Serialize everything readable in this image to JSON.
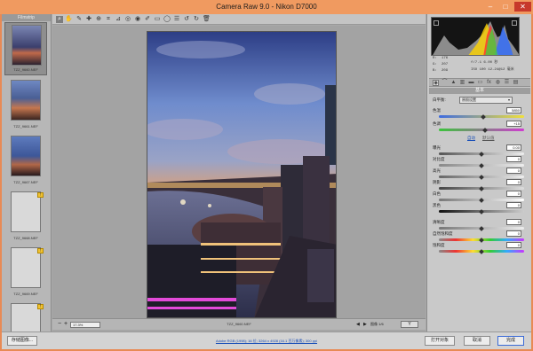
{
  "window": {
    "title": "Camera Raw 9.0  -  Nikon D7000",
    "minimize": "–",
    "maximize": "□",
    "close": "✕"
  },
  "filmstrip": {
    "header": "Filmstrip",
    "items": [
      {
        "name": "TZZ_9660.NEF",
        "stars": "· · · · ·",
        "selected": true,
        "warning": false,
        "has_image": true
      },
      {
        "name": "TZZ_9661.NEF",
        "stars": "",
        "selected": false,
        "warning": false,
        "has_image": true
      },
      {
        "name": "TZZ_9667.NEF",
        "stars": "",
        "selected": false,
        "warning": false,
        "has_image": true
      },
      {
        "name": "TZZ_9668.NEF",
        "stars": "",
        "selected": false,
        "warning": true,
        "has_image": false
      },
      {
        "name": "TZZ_9669.NEF",
        "stars": "",
        "selected": false,
        "warning": true,
        "has_image": false
      },
      {
        "name": "",
        "stars": "",
        "selected": false,
        "warning": true,
        "has_image": false
      }
    ]
  },
  "toolbar": {
    "icons": [
      "zoom-icon",
      "hand-icon",
      "white-balance-icon",
      "color-sampler-icon",
      "targeted-adjust-icon",
      "crop-icon",
      "straighten-icon",
      "spot-removal-icon",
      "red-eye-icon",
      "adjustment-brush-icon",
      "graduated-filter-icon",
      "radial-filter-icon",
      "preferences-icon",
      "rotate-left-icon",
      "rotate-right-icon",
      "trash-icon"
    ],
    "glyphs": [
      "⌕",
      "✋",
      "✎",
      "✚",
      "⊕",
      "⌗",
      "⊿",
      "◎",
      "◉",
      "✐",
      "▭",
      "◯",
      "☰",
      "↺",
      "↻",
      "🗑"
    ]
  },
  "canvas": {
    "filename": "TZZ_9660.NEF"
  },
  "status": {
    "zoom": "17.3%",
    "zoom_out": "−",
    "zoom_in": "+",
    "prev": "◀",
    "next": "▶",
    "page": "图像 1/6",
    "y_button": "Y"
  },
  "readout": {
    "r_label": "R:",
    "r": "176",
    "g_label": "G:",
    "g": "207",
    "b_label": "B:",
    "b": "209",
    "exposure": "f/7.1  6.00 秒",
    "iso": "ISO 100  12-24@12 毫米"
  },
  "panel": {
    "section": "基本",
    "white_balance_label": "白平衡:",
    "white_balance_value": "原照设置",
    "temperature_label": "色温",
    "temperature": "5850",
    "tint_label": "色调",
    "tint": "+15",
    "auto_link": "自动",
    "default_link": "默认值",
    "sliders": [
      {
        "label": "曝光",
        "value": "0.00"
      },
      {
        "label": "对比度",
        "value": "0"
      },
      {
        "label": "高光",
        "value": "0"
      },
      {
        "label": "阴影",
        "value": "0"
      },
      {
        "label": "白色",
        "value": "0"
      },
      {
        "label": "黑色",
        "value": "0"
      },
      {
        "label": "清晰度",
        "value": "0"
      },
      {
        "label": "自然饱和度",
        "value": "0"
      },
      {
        "label": "饱和度",
        "value": "0"
      }
    ]
  },
  "bottom": {
    "save_label": "存储图像...",
    "workflow_link": "Adobe RGB (1998); 16 位; 3264 x 4928 (16.1 百万像素); 300 ppi",
    "open_label": "打开对象",
    "cancel_label": "取消",
    "done_label": "完成"
  },
  "colors": {
    "title_bar": "#f09a60",
    "panel": "#c9c9c9",
    "canvas": "#a3a3a3",
    "accent": "#3a6ad6"
  }
}
